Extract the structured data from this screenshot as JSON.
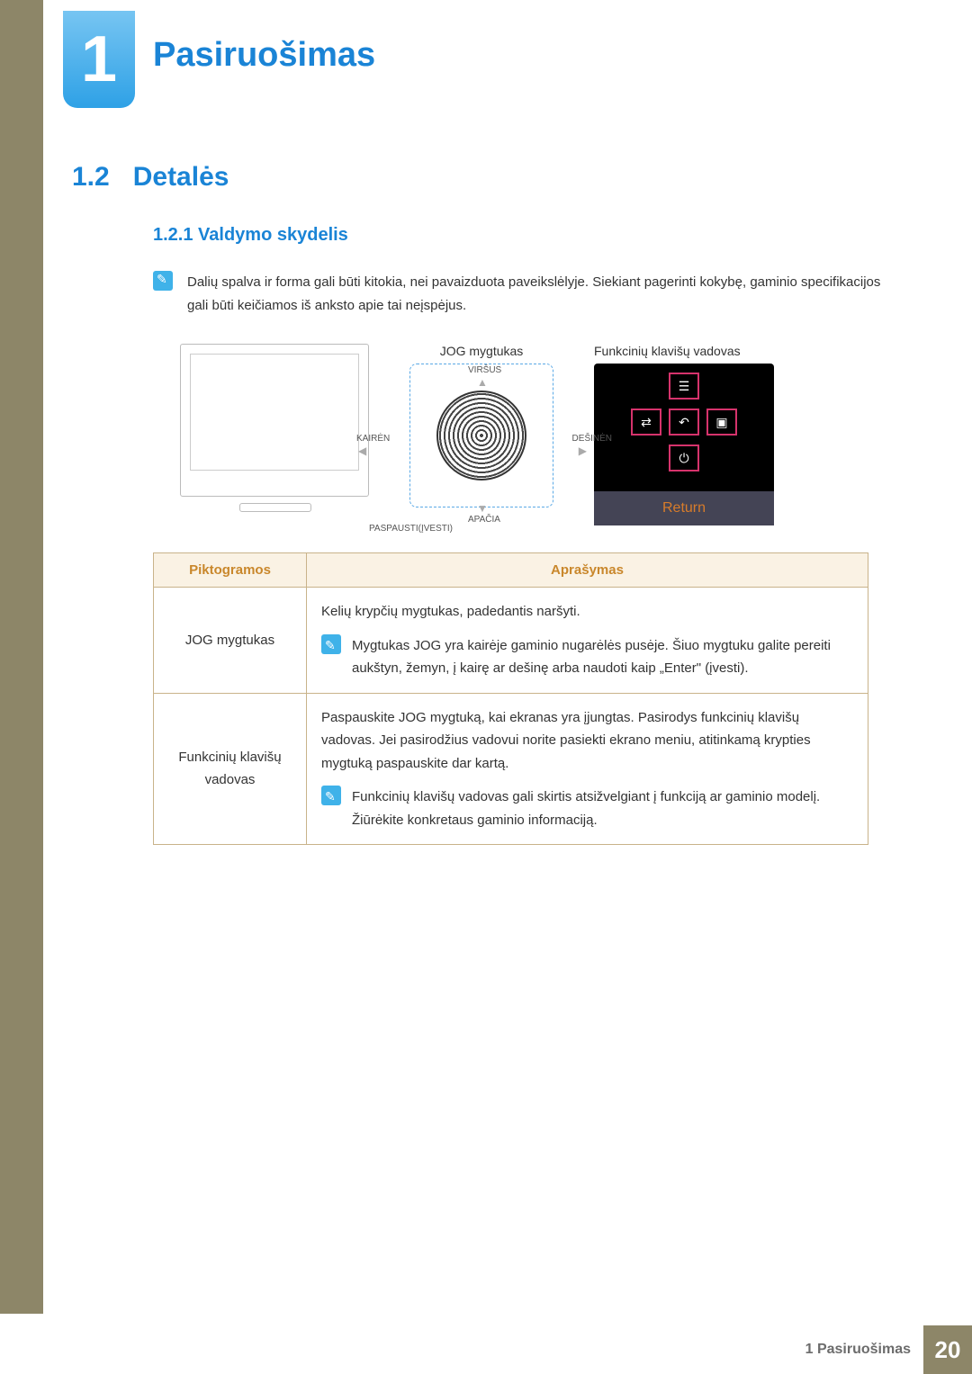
{
  "chapterNumber": "1",
  "chapterTitle": "Pasiruošimas",
  "section": {
    "number": "1.2",
    "title": "Detalės"
  },
  "subsection": {
    "number": "1.2.1",
    "title": "Valdymo skydelis"
  },
  "topNote": "Dalių spalva ir forma gali būti kitokia, nei pavaizduota paveikslėlyje. Siekiant pagerinti kokybę, gaminio specifikacijos gali būti keičiamos iš anksto apie tai neįspėjus.",
  "diagram": {
    "jogButtonLabel": "JOG mygtukas",
    "up": "VIRŠUS",
    "down": "APAČIA",
    "left": "KAIRĖN",
    "right": "DEŠINĖN",
    "pressEnter": "PASPAUSTI(ĮVESTI)",
    "guideTitle": "Funkcinių klavišų vadovas",
    "returnLabel": "Return"
  },
  "table": {
    "headers": {
      "icons": "Piktogramos",
      "desc": "Aprašymas"
    },
    "rows": [
      {
        "icon": "JOG mygtukas",
        "desc": "Kelių krypčių mygtukas, padedantis naršyti.",
        "note": "Mygtukas JOG yra kairėje gaminio nugarėlės pusėje. Šiuo mygtuku galite pereiti aukštyn, žemyn, į kairę ar dešinę arba naudoti kaip „Enter\" (įvesti)."
      },
      {
        "icon": "Funkcinių klavišų vadovas",
        "desc": "Paspauskite JOG mygtuką, kai ekranas yra įjungtas. Pasirodys funkcinių klavišų vadovas. Jei pasirodžius vadovui norite pasiekti ekrano meniu, atitinkamą krypties mygtuką paspauskite dar kartą.",
        "note": "Funkcinių klavišų vadovas gali skirtis atsižvelgiant į funkciją ar gaminio modelį. Žiūrėkite konkretaus gaminio informaciją."
      }
    ]
  },
  "footer": {
    "label": "1 Pasiruošimas",
    "page": "20"
  }
}
